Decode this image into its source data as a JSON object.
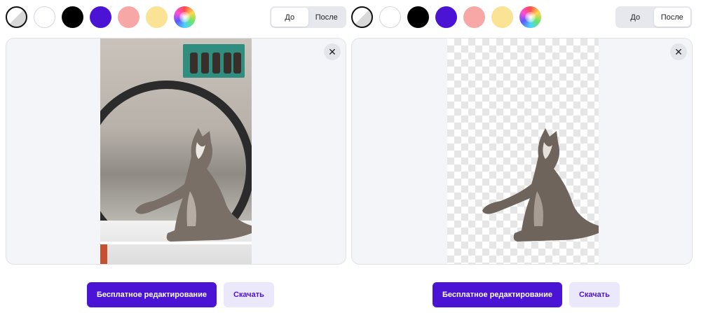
{
  "colors": {
    "swatches": [
      "transparent",
      "#ffffff",
      "#000000",
      "#4b14d4",
      "#f7a7a5",
      "#fbe396",
      "rainbow"
    ],
    "accent": "#4b14d4",
    "button_secondary_bg": "#ebe8fb"
  },
  "panels": [
    {
      "toggle": {
        "before": "До",
        "after": "После",
        "active": "before"
      },
      "image": "original-photo",
      "primary_button": "Бесплатное редактирование",
      "secondary_button": "Скачать"
    },
    {
      "toggle": {
        "before": "До",
        "after": "После",
        "active": "after"
      },
      "image": "background-removed-photo",
      "primary_button": "Бесплатное редактирование",
      "secondary_button": "Скачать"
    }
  ],
  "icons": {
    "close": "close-icon"
  }
}
